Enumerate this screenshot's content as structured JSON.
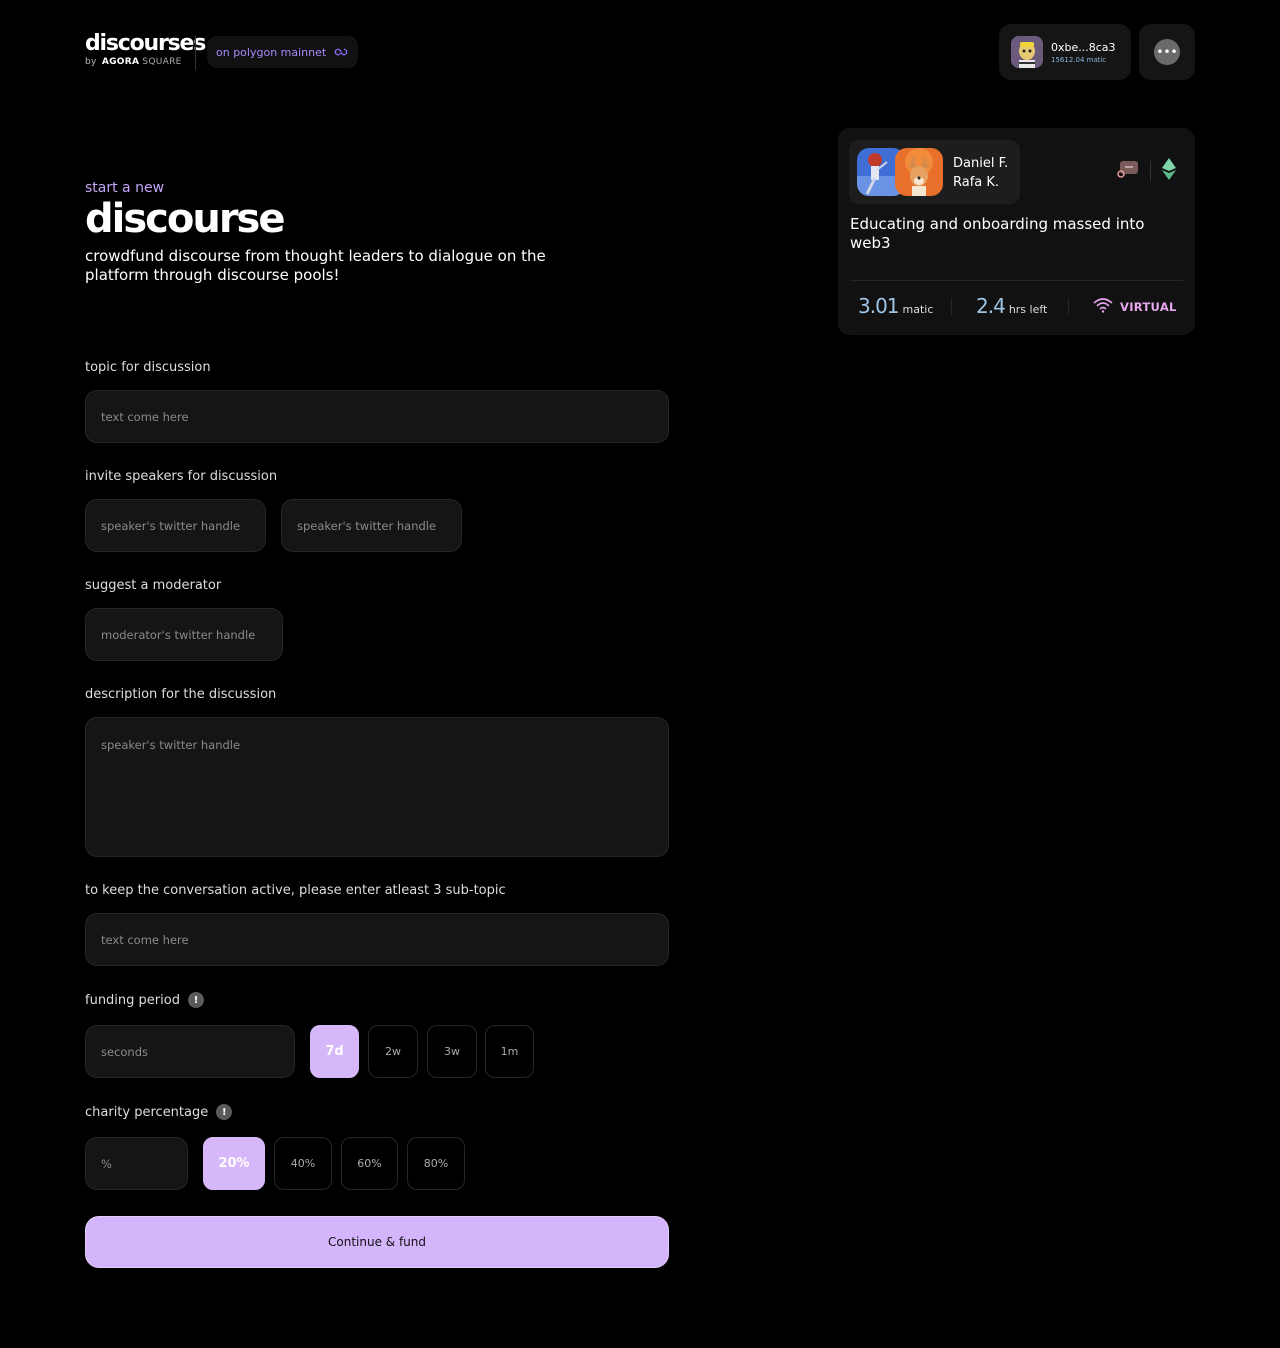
{
  "header": {
    "logo_title": "discourses",
    "logo_by": "by",
    "logo_agora": "AGORA",
    "logo_square": "SQUARE",
    "network_label": "on polygon mainnet",
    "wallet_address": "0xbe...8ca3",
    "wallet_balance": "15612.04 matic",
    "more_icon": "ellipsis-icon"
  },
  "hero": {
    "eyebrow": "start a new",
    "title": "discourse",
    "description": "crowdfund discourse from thought leaders to dialogue on the platform through discourse pools!"
  },
  "form": {
    "topic_label": "topic for discussion",
    "topic_placeholder": "text come here",
    "speakers_label": "invite speakers for discussion",
    "speaker1_placeholder": "speaker's twitter handle",
    "speaker2_placeholder": "speaker's twitter handle",
    "moderator_label": "suggest a moderator",
    "moderator_placeholder": "moderator's twitter handle",
    "description_label": "description for the discussion",
    "description_placeholder": "speaker's twitter handle",
    "subtopic_label": "to keep the conversation active, please enter atleast 3 sub-topic",
    "subtopic_placeholder": "text come here",
    "funding_label": "funding period",
    "funding_placeholder": "seconds",
    "funding_options": [
      "7d",
      "2w",
      "3w",
      "1m"
    ],
    "funding_selected": "7d",
    "charity_label": "charity percentage",
    "charity_placeholder": "%",
    "charity_options": [
      "20%",
      "40%",
      "60%",
      "80%"
    ],
    "charity_selected": "20%",
    "info_glyph": "!",
    "submit_label": "Continue & fund"
  },
  "card": {
    "speaker1": "Daniel F.",
    "speaker2": "Rafa K.",
    "title": "Educating and onboarding massed into web3",
    "funds_value": "3.01",
    "funds_unit": "matic",
    "time_value": "2.4",
    "time_unit": "hrs left",
    "mode": "VIRTUAL",
    "icons": [
      "chat-icon",
      "ethereum-icon",
      "wifi-icon"
    ]
  },
  "colors": {
    "accent": "#d4b4fa",
    "link": "#a78bfa",
    "stat": "#9ec4e6",
    "virtual": "#e7a6ef"
  }
}
